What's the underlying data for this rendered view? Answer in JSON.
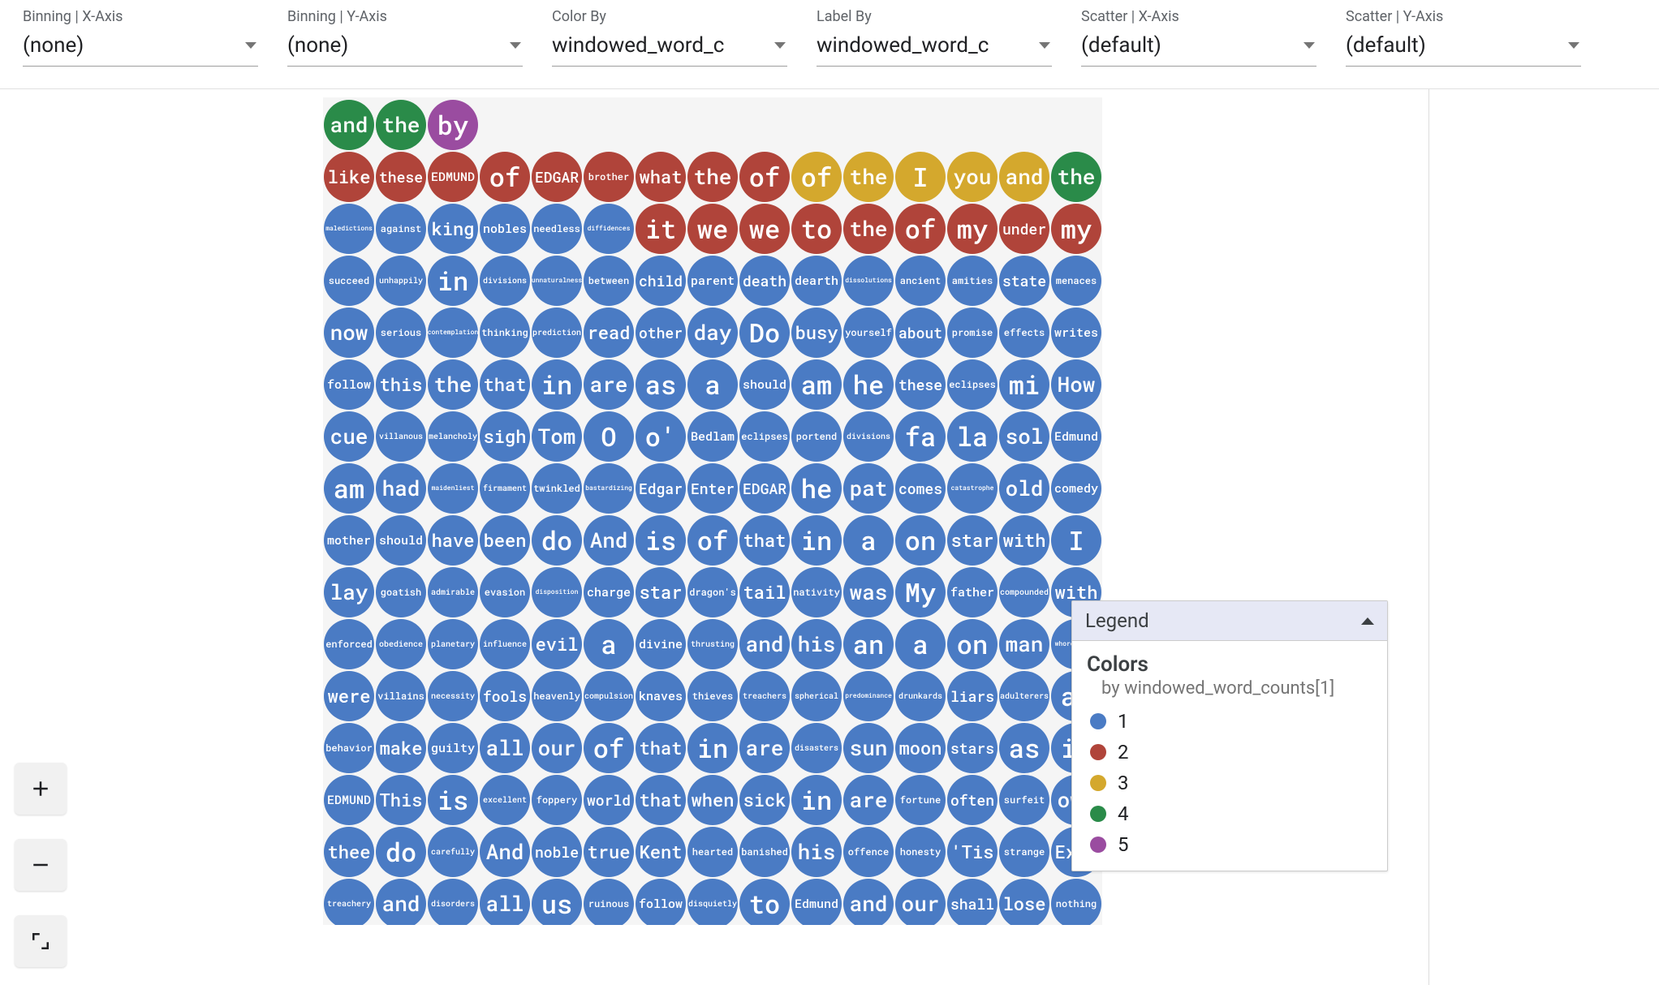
{
  "controls": [
    {
      "label": "Binning | X-Axis",
      "value": "(none)"
    },
    {
      "label": "Binning | Y-Axis",
      "value": "(none)"
    },
    {
      "label": "Color By",
      "value": "windowed_word_c"
    },
    {
      "label": "Label By",
      "value": "windowed_word_c"
    },
    {
      "label": "Scatter | X-Axis",
      "value": "(default)"
    },
    {
      "label": "Scatter | Y-Axis",
      "value": "(default)"
    }
  ],
  "zoom": {
    "in": "+",
    "out": "−",
    "reset": "⤢"
  },
  "legend": {
    "title": "Legend",
    "section": "Colors",
    "subtitle": "by windowed_word_counts[1]",
    "items": [
      {
        "label": "1",
        "color": "#4a7bc4"
      },
      {
        "label": "2",
        "color": "#b0443a"
      },
      {
        "label": "3",
        "color": "#d4a82d"
      },
      {
        "label": "4",
        "color": "#2a8b49"
      },
      {
        "label": "5",
        "color": "#9a4ca0"
      }
    ]
  },
  "dots": [
    [
      "and",
      4
    ],
    [
      "the",
      4
    ],
    [
      "by",
      5
    ],
    [
      "like",
      2
    ],
    [
      "these",
      2
    ],
    [
      "EDMUND",
      2
    ],
    [
      "of",
      2
    ],
    [
      "EDGAR",
      2
    ],
    [
      "brother",
      2
    ],
    [
      "what",
      2
    ],
    [
      "the",
      2
    ],
    [
      "of",
      2
    ],
    [
      "of",
      3
    ],
    [
      "the",
      3
    ],
    [
      "I",
      3
    ],
    [
      "you",
      3
    ],
    [
      "and",
      3
    ],
    [
      "the",
      4
    ],
    [
      "maledictions",
      1
    ],
    [
      "against",
      1
    ],
    [
      "king",
      1
    ],
    [
      "nobles",
      1
    ],
    [
      "needless",
      1
    ],
    [
      "diffidences",
      1
    ],
    [
      "it",
      2
    ],
    [
      "we",
      2
    ],
    [
      "we",
      2
    ],
    [
      "to",
      2
    ],
    [
      "the",
      2
    ],
    [
      "of",
      2
    ],
    [
      "my",
      2
    ],
    [
      "under",
      2
    ],
    [
      "my",
      2
    ],
    [
      "succeed",
      1
    ],
    [
      "unhappily",
      1
    ],
    [
      "in",
      1
    ],
    [
      "divisions",
      1
    ],
    [
      "unnaturalness",
      1
    ],
    [
      "between",
      1
    ],
    [
      "child",
      1
    ],
    [
      "parent",
      1
    ],
    [
      "death",
      1
    ],
    [
      "dearth",
      1
    ],
    [
      "dissolutions",
      1
    ],
    [
      "ancient",
      1
    ],
    [
      "amities",
      1
    ],
    [
      "state",
      1
    ],
    [
      "menaces",
      1
    ],
    [
      "now",
      1
    ],
    [
      "serious",
      1
    ],
    [
      "contemplation",
      1
    ],
    [
      "thinking",
      1
    ],
    [
      "prediction",
      1
    ],
    [
      "read",
      1
    ],
    [
      "other",
      1
    ],
    [
      "day",
      1
    ],
    [
      "Do",
      1
    ],
    [
      "busy",
      1
    ],
    [
      "yourself",
      1
    ],
    [
      "about",
      1
    ],
    [
      "promise",
      1
    ],
    [
      "effects",
      1
    ],
    [
      "writes",
      1
    ],
    [
      "follow",
      1
    ],
    [
      "this",
      1
    ],
    [
      "the",
      1
    ],
    [
      "that",
      1
    ],
    [
      "in",
      1
    ],
    [
      "are",
      1
    ],
    [
      "as",
      1
    ],
    [
      "a",
      1
    ],
    [
      "should",
      1
    ],
    [
      "am",
      1
    ],
    [
      "he",
      1
    ],
    [
      "these",
      1
    ],
    [
      "eclipses",
      1
    ],
    [
      "mi",
      1
    ],
    [
      "How",
      1
    ],
    [
      "cue",
      1
    ],
    [
      "villanous",
      1
    ],
    [
      "melancholy",
      1
    ],
    [
      "sigh",
      1
    ],
    [
      "Tom",
      1
    ],
    [
      "O",
      1
    ],
    [
      "o'",
      1
    ],
    [
      "Bedlam",
      1
    ],
    [
      "eclipses",
      1
    ],
    [
      "portend",
      1
    ],
    [
      "divisions",
      1
    ],
    [
      "fa",
      1
    ],
    [
      "la",
      1
    ],
    [
      "sol",
      1
    ],
    [
      "Edmund",
      1
    ],
    [
      "am",
      1
    ],
    [
      "had",
      1
    ],
    [
      "maidenliest",
      1
    ],
    [
      "firmament",
      1
    ],
    [
      "twinkled",
      1
    ],
    [
      "bastardizing",
      1
    ],
    [
      "Edgar",
      1
    ],
    [
      "Enter",
      1
    ],
    [
      "EDGAR",
      1
    ],
    [
      "he",
      1
    ],
    [
      "pat",
      1
    ],
    [
      "comes",
      1
    ],
    [
      "catastrophe",
      1
    ],
    [
      "old",
      1
    ],
    [
      "comedy",
      1
    ],
    [
      "mother",
      1
    ],
    [
      "should",
      1
    ],
    [
      "have",
      1
    ],
    [
      "been",
      1
    ],
    [
      "do",
      1
    ],
    [
      "And",
      1
    ],
    [
      "is",
      1
    ],
    [
      "of",
      1
    ],
    [
      "that",
      1
    ],
    [
      "in",
      1
    ],
    [
      "a",
      1
    ],
    [
      "on",
      1
    ],
    [
      "star",
      1
    ],
    [
      "with",
      1
    ],
    [
      "I",
      1
    ],
    [
      "lay",
      1
    ],
    [
      "goatish",
      1
    ],
    [
      "admirable",
      1
    ],
    [
      "evasion",
      1
    ],
    [
      "disposition",
      1
    ],
    [
      "charge",
      1
    ],
    [
      "star",
      1
    ],
    [
      "dragon's",
      1
    ],
    [
      "tail",
      1
    ],
    [
      "nativity",
      1
    ],
    [
      "was",
      1
    ],
    [
      "My",
      1
    ],
    [
      "father",
      1
    ],
    [
      "compounded",
      1
    ],
    [
      "with",
      1
    ],
    [
      "enforced",
      1
    ],
    [
      "obedience",
      1
    ],
    [
      "planetary",
      1
    ],
    [
      "influence",
      1
    ],
    [
      "evil",
      1
    ],
    [
      "a",
      1
    ],
    [
      "divine",
      1
    ],
    [
      "thrusting",
      1
    ],
    [
      "and",
      1
    ],
    [
      "his",
      1
    ],
    [
      "an",
      1
    ],
    [
      "a",
      1
    ],
    [
      "on",
      1
    ],
    [
      "man",
      1
    ],
    [
      "whoremaster",
      1
    ],
    [
      "were",
      1
    ],
    [
      "villains",
      1
    ],
    [
      "necessity",
      1
    ],
    [
      "fools",
      1
    ],
    [
      "heavenly",
      1
    ],
    [
      "compulsion",
      1
    ],
    [
      "knaves",
      1
    ],
    [
      "thieves",
      1
    ],
    [
      "treachers",
      1
    ],
    [
      "spherical",
      1
    ],
    [
      "predominance",
      1
    ],
    [
      "drunkards",
      1
    ],
    [
      "liars",
      1
    ],
    [
      "adulterers",
      1
    ],
    [
      "an",
      1
    ],
    [
      "behavior",
      1
    ],
    [
      "make",
      1
    ],
    [
      "guilty",
      1
    ],
    [
      "all",
      1
    ],
    [
      "our",
      1
    ],
    [
      "of",
      1
    ],
    [
      "that",
      1
    ],
    [
      "in",
      1
    ],
    [
      "are",
      1
    ],
    [
      "disasters",
      1
    ],
    [
      "sun",
      1
    ],
    [
      "moon",
      1
    ],
    [
      "stars",
      1
    ],
    [
      "as",
      1
    ],
    [
      "if",
      1
    ],
    [
      "EDMUND",
      1
    ],
    [
      "This",
      1
    ],
    [
      "is",
      1
    ],
    [
      "excellent",
      1
    ],
    [
      "foppery",
      1
    ],
    [
      "world",
      1
    ],
    [
      "that",
      1
    ],
    [
      "when",
      1
    ],
    [
      "sick",
      1
    ],
    [
      "in",
      1
    ],
    [
      "are",
      1
    ],
    [
      "fortune",
      1
    ],
    [
      "often",
      1
    ],
    [
      "surfeit",
      1
    ],
    [
      "own",
      1
    ],
    [
      "thee",
      1
    ],
    [
      "do",
      1
    ],
    [
      "carefully",
      1
    ],
    [
      "And",
      1
    ],
    [
      "noble",
      1
    ],
    [
      "true",
      1
    ],
    [
      "Kent",
      1
    ],
    [
      "hearted",
      1
    ],
    [
      "banished",
      1
    ],
    [
      "his",
      1
    ],
    [
      "offence",
      1
    ],
    [
      "honesty",
      1
    ],
    [
      "'Tis",
      1
    ],
    [
      "strange",
      1
    ],
    [
      "Exit",
      1
    ],
    [
      "treachery",
      1
    ],
    [
      "and",
      1
    ],
    [
      "disorders",
      1
    ],
    [
      "all",
      1
    ],
    [
      "us",
      1
    ],
    [
      "ruinous",
      1
    ],
    [
      "follow",
      1
    ],
    [
      "disquietly",
      1
    ],
    [
      "to",
      1
    ],
    [
      "Edmund",
      1
    ],
    [
      "and",
      1
    ],
    [
      "our",
      1
    ],
    [
      "shall",
      1
    ],
    [
      "lose",
      1
    ],
    [
      "nothing",
      1
    ]
  ]
}
